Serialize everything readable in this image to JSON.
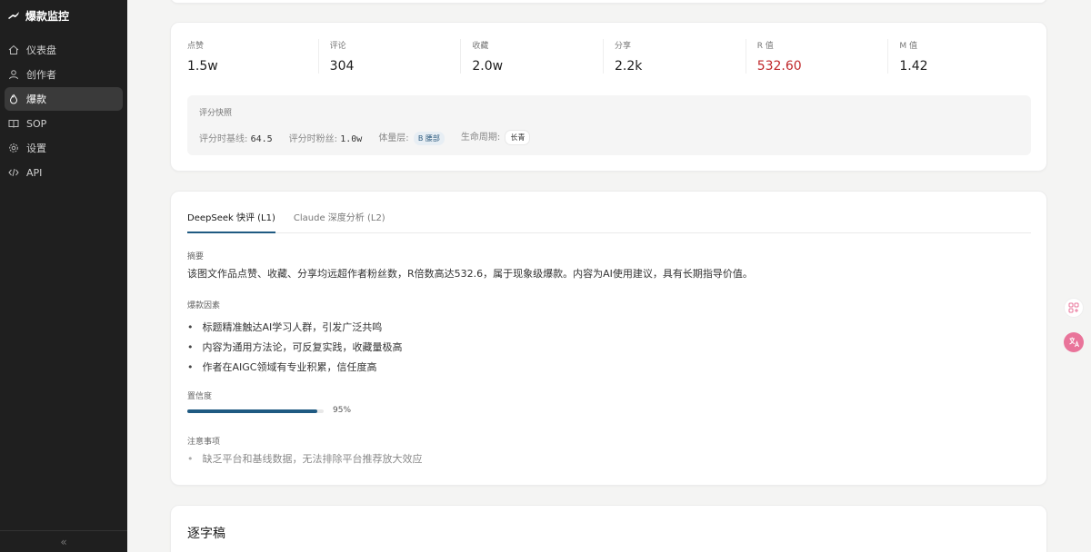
{
  "app": {
    "title": "爆款监控"
  },
  "sidebar": {
    "items": [
      {
        "label": "仪表盘",
        "icon": "dashboard-icon"
      },
      {
        "label": "创作者",
        "icon": "user-icon"
      },
      {
        "label": "爆款",
        "icon": "fire-icon",
        "active": true
      },
      {
        "label": "SOP",
        "icon": "book-icon"
      },
      {
        "label": "设置",
        "icon": "gear-icon"
      },
      {
        "label": "API",
        "icon": "code-icon"
      }
    ],
    "collapse_label": "«"
  },
  "stats": [
    {
      "label": "点赞",
      "value": "1.5w"
    },
    {
      "label": "评论",
      "value": "304"
    },
    {
      "label": "收藏",
      "value": "2.0w"
    },
    {
      "label": "分享",
      "value": "2.2k"
    },
    {
      "label": "R 值",
      "value": "532.60",
      "highlight": "#c0282b"
    },
    {
      "label": "M 值",
      "value": "1.42"
    }
  ],
  "snapshot": {
    "title": "评分快照",
    "baseline_label": "评分时基线:",
    "baseline_value": "64.5",
    "fans_label": "评分时粉丝:",
    "fans_value": "1.0w",
    "tier_label": "体量层:",
    "tier_value": "B 腰部",
    "lifecycle_label": "生命周期:",
    "lifecycle_value": "长青"
  },
  "analysis": {
    "tabs": [
      {
        "label": "DeepSeek 快评 (L1)",
        "active": true
      },
      {
        "label": "Claude 深度分析 (L2)",
        "active": false
      }
    ],
    "summary_label": "摘要",
    "summary": "该图文作品点赞、收藏、分享均远超作者粉丝数，R倍数高达532.6，属于现象级爆款。内容为AI使用建议，具有长期指导价值。",
    "factors_label": "爆款因素",
    "factors": [
      "标题精准触达AI学习人群，引发广泛共鸣",
      "内容为通用方法论，可反复实践，收藏量极高",
      "作者在AIGC领域有专业积累，信任度高"
    ],
    "confidence_label": "置信度",
    "confidence_value": 0.95,
    "confidence_text": "95%",
    "notes_label": "注意事项",
    "notes": [
      "缺乏平台和基线数据，无法排除平台推荐放大效应"
    ]
  },
  "transcript": {
    "title": "逐字稿"
  },
  "colors": {
    "accent": "#1f5a82",
    "danger": "#c0282b",
    "sidebar_bg": "#1f1f1f"
  }
}
